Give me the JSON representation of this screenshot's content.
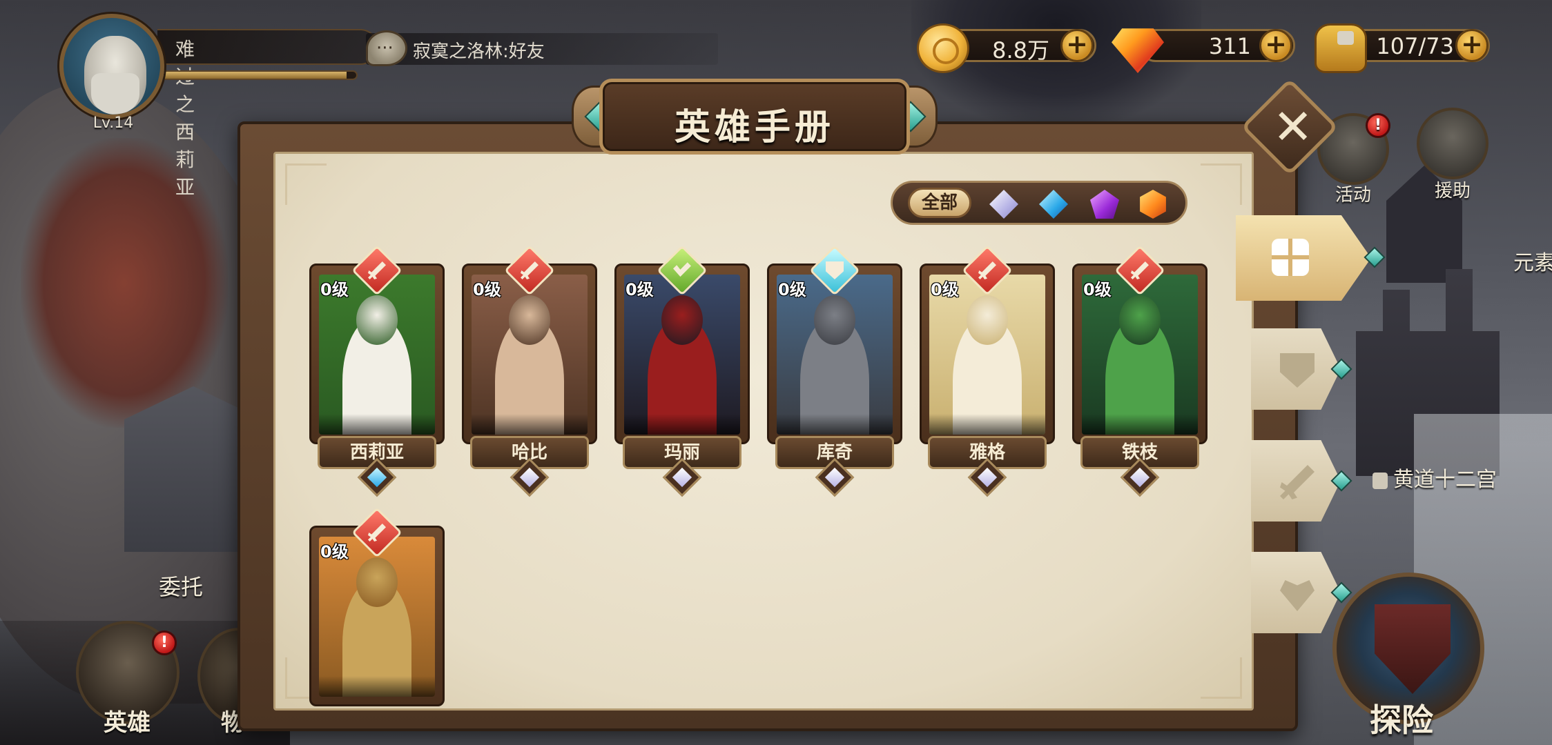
{
  "player": {
    "name": "难过之西莉亚",
    "level": "Lv.14",
    "exp_fraction": 0.95
  },
  "chat": {
    "message": "寂寞之洛林:好友"
  },
  "currencies": {
    "gold": "8.8万",
    "diamonds": "311",
    "stamina": "107/73"
  },
  "side_nav": {
    "activity": "活动",
    "assist": "援助",
    "element_partial": "元素",
    "zodiac": "黄道十二宫",
    "explore": "探险"
  },
  "bottom_nav": {
    "commission": "委托",
    "heroes": "英雄",
    "items_partial": "物"
  },
  "panel": {
    "title": "英雄手册",
    "close": "✕",
    "filter_all": "全部"
  },
  "heroes": [
    {
      "name": "西莉亚",
      "level": "0级",
      "role": "red",
      "rarity": "blue",
      "palette": [
        "#3c7a2c",
        "#f2efe6",
        "#2a5a22"
      ]
    },
    {
      "name": "哈比",
      "level": "0级",
      "role": "red",
      "rarity": "white",
      "palette": [
        "#8a5e48",
        "#d8b89a",
        "#4e3424"
      ]
    },
    {
      "name": "玛丽",
      "level": "0级",
      "role": "green",
      "rarity": "white",
      "palette": [
        "#3a4a6a",
        "#9a1e1e",
        "#1e1a22"
      ]
    },
    {
      "name": "库奇",
      "level": "0级",
      "role": "cyan",
      "rarity": "white",
      "palette": [
        "#4a6a8a",
        "#7c7f86",
        "#3a3c42"
      ]
    },
    {
      "name": "雅格",
      "level": "0级",
      "role": "red",
      "rarity": "white",
      "palette": [
        "#e8d9a8",
        "#f4ecd8",
        "#c9b070"
      ]
    },
    {
      "name": "铁枝",
      "level": "0级",
      "role": "red",
      "rarity": "white",
      "palette": [
        "#2e6a3a",
        "#4ea24a",
        "#1a3a22"
      ]
    },
    {
      "name": "",
      "level": "0级",
      "role": "red",
      "rarity": "",
      "palette": [
        "#d98a3a",
        "#c9a45a",
        "#8a5a22"
      ]
    }
  ],
  "colors": {
    "accent_gold": "#d8b474",
    "panel_paper": "#f1ead8",
    "frame_brown": "#6b4c34"
  }
}
